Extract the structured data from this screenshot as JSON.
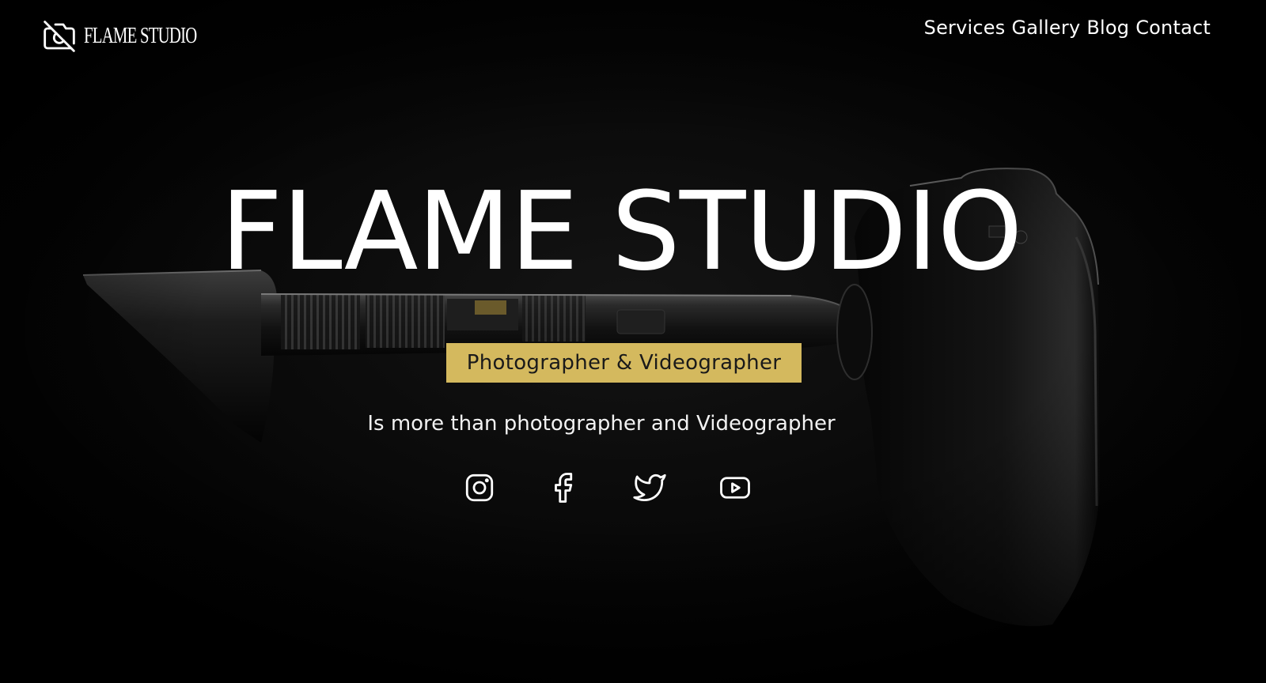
{
  "header": {
    "logo_text": "FLAME STUDIO",
    "logo_ghost_text": "STUDIO",
    "logo_icon": "camera-off-icon",
    "nav": [
      {
        "label": "Services"
      },
      {
        "label": "Gallery"
      },
      {
        "label": "Blog"
      },
      {
        "label": "Contact"
      }
    ]
  },
  "hero": {
    "title": "FLAME STUDIO",
    "subtitle": "Photographer & Videographer",
    "tagline": "Is more than photographer and Videographer",
    "accent_color": "#d4b95e"
  },
  "socials": [
    {
      "icon": "instagram-icon"
    },
    {
      "icon": "facebook-icon"
    },
    {
      "icon": "twitter-icon"
    },
    {
      "icon": "youtube-icon"
    }
  ]
}
